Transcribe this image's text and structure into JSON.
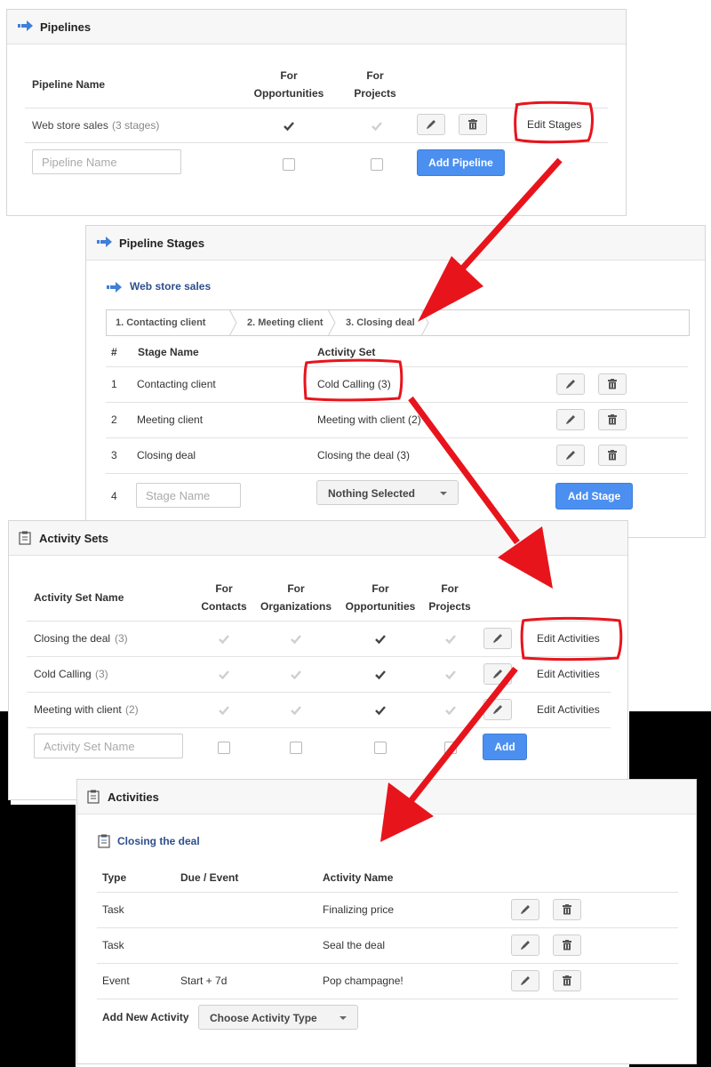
{
  "pipelines": {
    "title": "Pipelines",
    "col_name": "Pipeline Name",
    "col_opp_1": "For",
    "col_opp_2": "Opportunities",
    "col_proj_1": "For",
    "col_proj_2": "Projects",
    "row": {
      "name": "Web store sales",
      "meta": "(3 stages)",
      "edit_stages": "Edit Stages"
    },
    "new_placeholder": "Pipeline Name",
    "add_label": "Add Pipeline"
  },
  "stages": {
    "title": "Pipeline Stages",
    "pipeline_name": "Web store sales",
    "crumbs": [
      "1. Contacting client",
      "2. Meeting client",
      "3. Closing deal"
    ],
    "col_num": "#",
    "col_name": "Stage Name",
    "col_set": "Activity Set",
    "rows": [
      {
        "num": "1",
        "name": "Contacting client",
        "set": "Cold Calling (3)"
      },
      {
        "num": "2",
        "name": "Meeting client",
        "set": "Meeting with client (2)"
      },
      {
        "num": "3",
        "name": "Closing deal",
        "set": "Closing the deal (3)"
      }
    ],
    "new_num": "4",
    "new_placeholder": "Stage Name",
    "select_value": "Nothing Selected",
    "add_label": "Add Stage"
  },
  "activity_sets": {
    "title": "Activity Sets",
    "col_name": "Activity Set Name",
    "cols": [
      {
        "l1": "For",
        "l2": "Contacts"
      },
      {
        "l1": "For",
        "l2": "Organizations"
      },
      {
        "l1": "For",
        "l2": "Opportunities"
      },
      {
        "l1": "For",
        "l2": "Projects"
      }
    ],
    "rows": [
      {
        "name": "Closing the deal",
        "meta": "(3)",
        "edit": "Edit Activities"
      },
      {
        "name": "Cold Calling",
        "meta": "(3)",
        "edit": "Edit Activities"
      },
      {
        "name": "Meeting with client",
        "meta": "(2)",
        "edit": "Edit Activities"
      }
    ],
    "new_placeholder": "Activity Set Name",
    "add_label": "Add"
  },
  "activities": {
    "title": "Activities",
    "set_name": "Closing the deal",
    "col_type": "Type",
    "col_due": "Due / Event",
    "col_name": "Activity Name",
    "rows": [
      {
        "type": "Task",
        "due": "",
        "name": "Finalizing price"
      },
      {
        "type": "Task",
        "due": "",
        "name": "Seal the deal"
      },
      {
        "type": "Event",
        "due": "Start + 7d",
        "name": "Pop champagne!"
      }
    ],
    "add_new_label": "Add New Activity",
    "choose_type": "Choose Activity Type"
  },
  "colors": {
    "primary_button": "#4b8ff0",
    "annotation_red": "#e8141c",
    "link": "#2d4f8c"
  }
}
